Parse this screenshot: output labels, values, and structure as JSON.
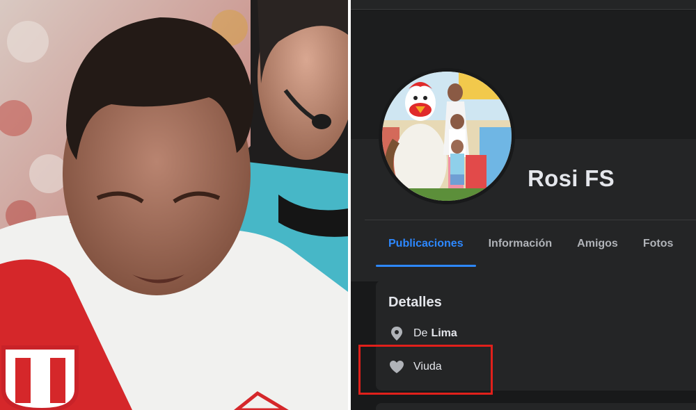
{
  "profile": {
    "name": "Rosi FS"
  },
  "tabs": [
    {
      "label": "Publicaciones",
      "active": true
    },
    {
      "label": "Información",
      "active": false
    },
    {
      "label": "Amigos",
      "active": false
    },
    {
      "label": "Fotos",
      "active": false
    }
  ],
  "details": {
    "title": "Detalles",
    "location_prefix": "De",
    "location_city": "Lima",
    "relationship": "Viuda"
  },
  "icons": {
    "location": "map-pin-icon",
    "relationship": "heart-icon"
  },
  "colors": {
    "accent": "#2d88ff",
    "highlight": "#e0201b",
    "background": "#18191a",
    "card": "#242526"
  }
}
